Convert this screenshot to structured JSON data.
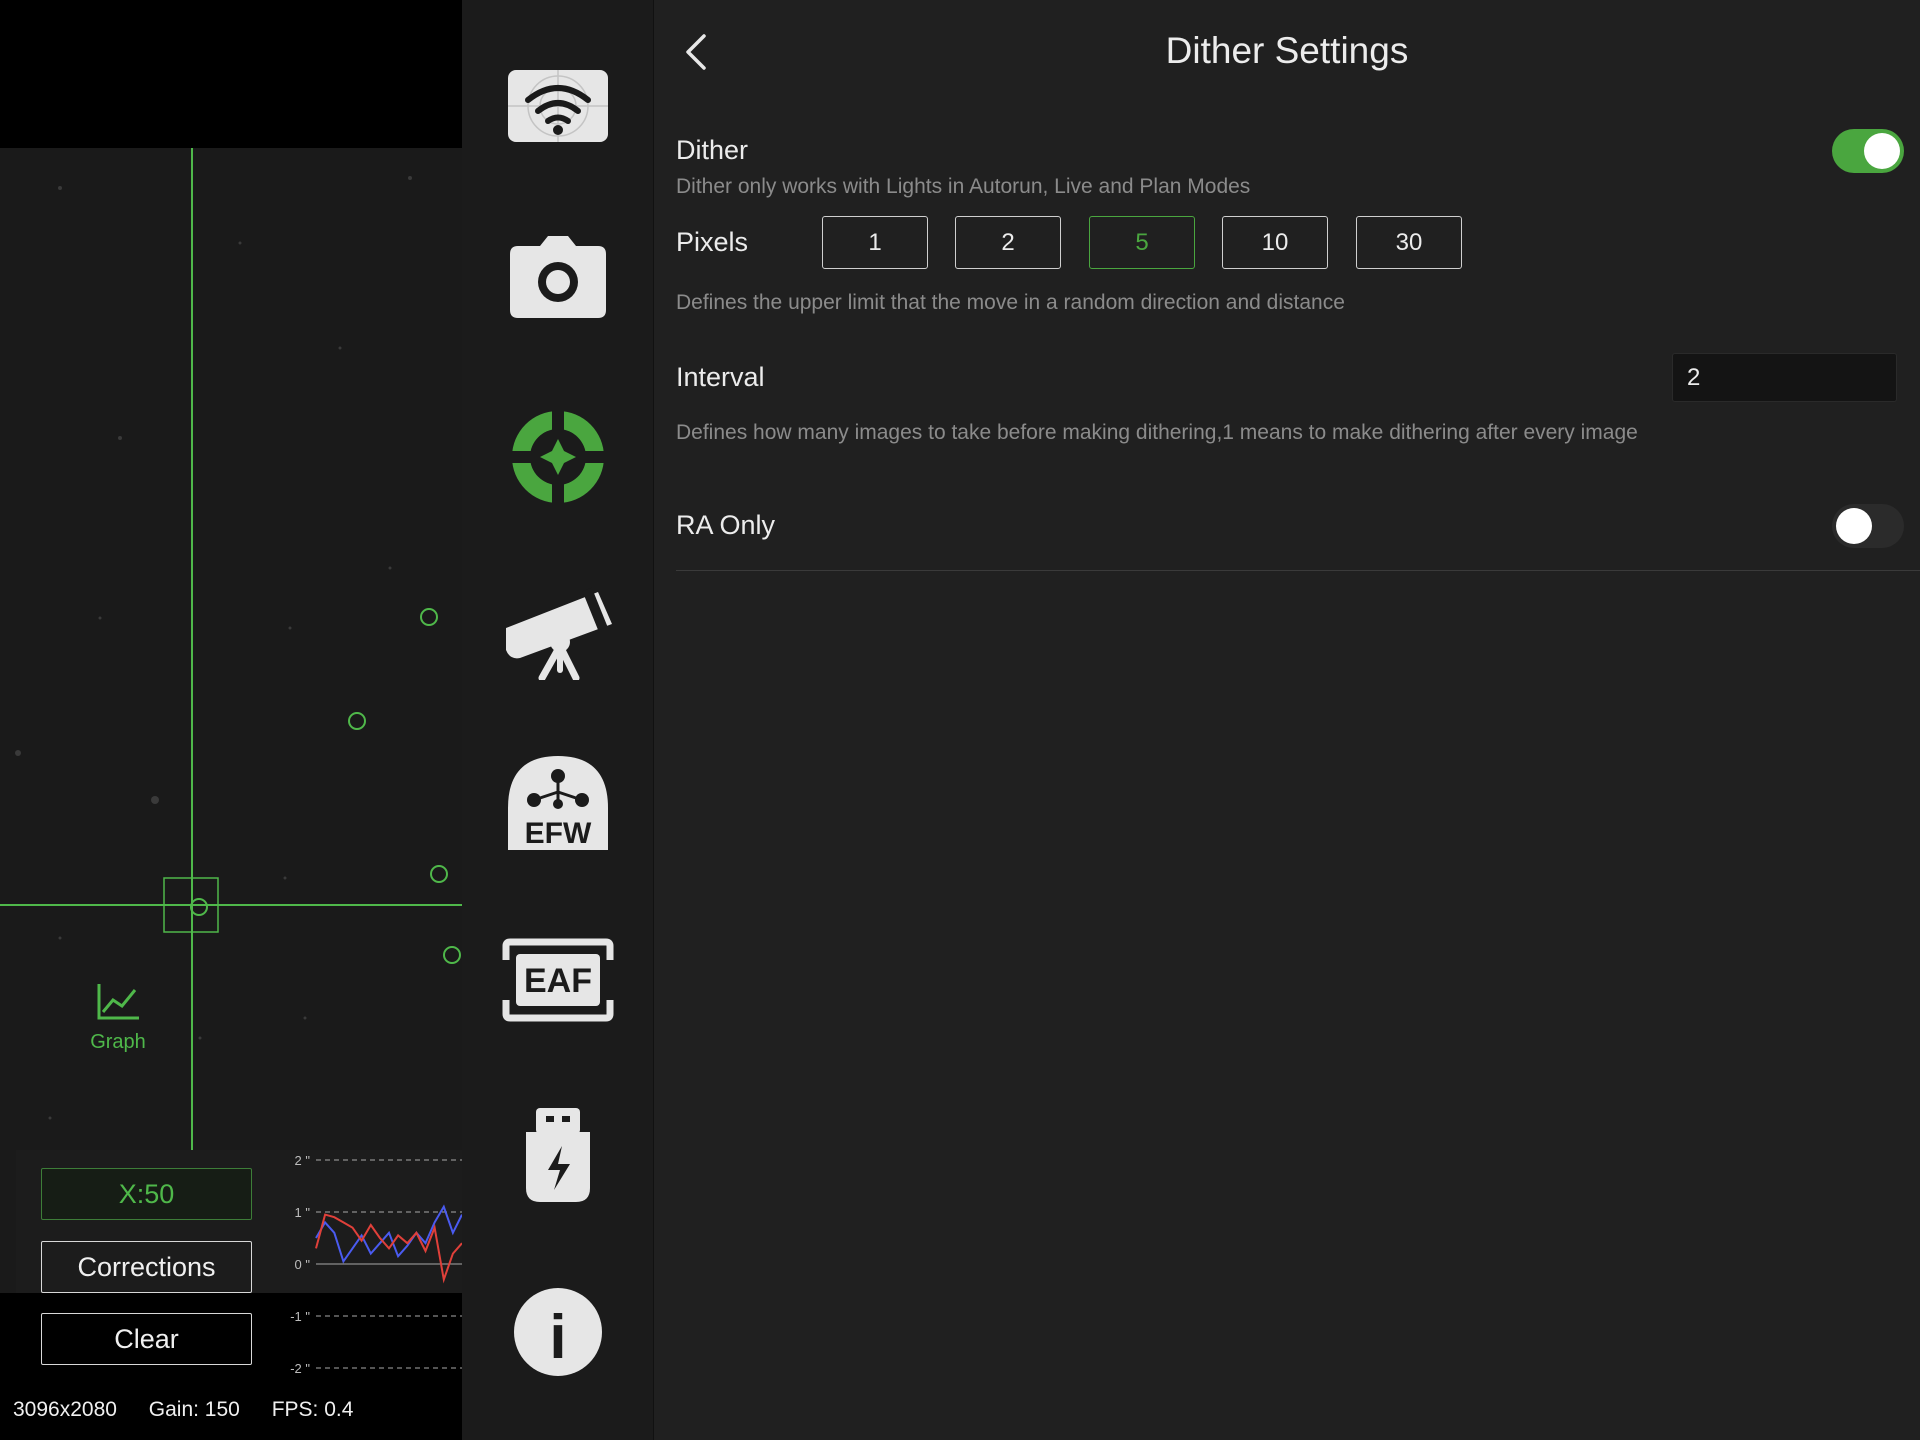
{
  "guide": {
    "graph_label": "Graph",
    "x_button": "X:50",
    "corrections_button": "Corrections",
    "clear_button": "Clear",
    "status": {
      "resolution": "3096x2080",
      "gain": "Gain: 150",
      "fps": "FPS: 0.4"
    },
    "colors": {
      "accent": "#4fb84a",
      "ra_series": "#4a5bf0",
      "dec_series": "#e0403a"
    }
  },
  "chart_data": {
    "type": "line",
    "y_ticks": [
      "2 \"",
      "1 \"",
      "0 \"",
      "-1 \"",
      "-2 \""
    ],
    "ylim": [
      -2,
      2
    ],
    "grid": true,
    "series": [
      {
        "values": [
          0.5,
          0.8,
          0.6,
          0.05,
          0.3,
          0.55,
          0.2,
          0.4,
          0.6,
          0.15,
          0.35,
          0.6,
          0.4,
          0.8,
          1.1,
          0.6,
          0.95
        ]
      },
      {
        "values": [
          0.3,
          0.95,
          0.9,
          0.8,
          0.7,
          0.45,
          0.75,
          0.5,
          0.3,
          0.55,
          0.4,
          0.6,
          0.25,
          0.7,
          -0.3,
          0.2,
          0.4
        ]
      }
    ]
  },
  "sidebar": {
    "items": [
      {
        "icon": "wifi-icon"
      },
      {
        "icon": "camera-icon"
      },
      {
        "icon": "guide-target-icon"
      },
      {
        "icon": "telescope-icon"
      },
      {
        "icon": "efw-icon",
        "text": "EFW"
      },
      {
        "icon": "eaf-icon",
        "text": "EAF"
      },
      {
        "icon": "usb-power-icon"
      },
      {
        "icon": "info-icon",
        "text": "i"
      }
    ]
  },
  "settings": {
    "title": "Dither Settings",
    "dither": {
      "label": "Dither",
      "enabled": true,
      "description": "Dither only works with Lights in Autorun, Live and Plan Modes"
    },
    "pixels": {
      "label": "Pixels",
      "options": [
        "1",
        "2",
        "5",
        "10",
        "30"
      ],
      "selected": "5",
      "description": "Defines the upper limit that the move in a random direction and distance"
    },
    "interval": {
      "label": "Interval",
      "value": "2",
      "description": "Defines how many images to take before making dithering,1 means to make dithering after every image"
    },
    "ra_only": {
      "label": "RA Only",
      "enabled": false
    },
    "colors": {
      "accent": "#4aa63f"
    }
  }
}
